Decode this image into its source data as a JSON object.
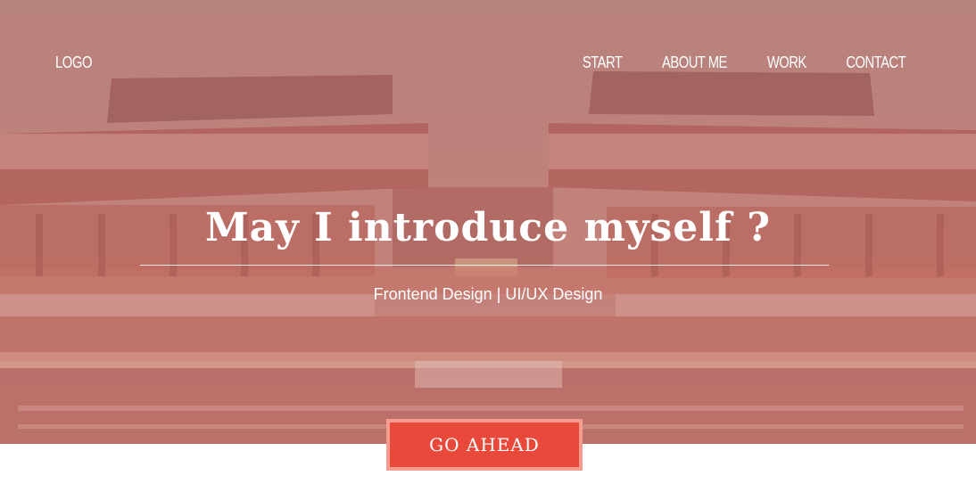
{
  "header": {
    "logo": "LOGO"
  },
  "nav": {
    "items": [
      "START",
      "ABOUT ME",
      "WORK",
      "CONTACT"
    ]
  },
  "hero": {
    "title": "May I introduce myself ?",
    "subtitle": "Frontend Design | UI/UX Design",
    "cta_label": "GO AHEAD"
  },
  "colors": {
    "accent": "#e8493a",
    "accent_border": "#f59c8e",
    "hero_tint": "#b98079"
  }
}
